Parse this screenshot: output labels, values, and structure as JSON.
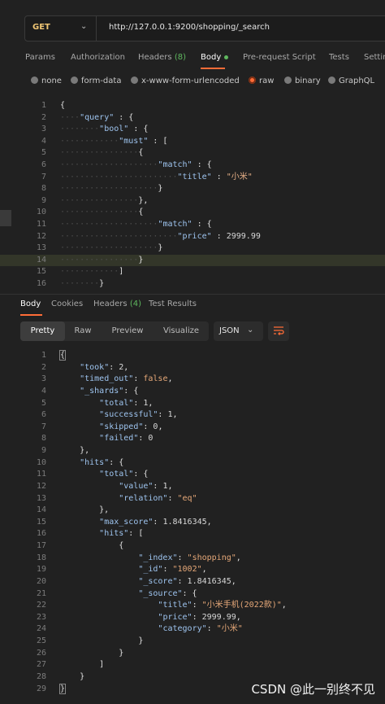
{
  "request": {
    "method": "GET",
    "url": "http://127.0.0.1:9200/shopping/_search"
  },
  "request_tabs": {
    "params": "Params",
    "authorization": "Authorization",
    "headers": "Headers",
    "headers_count": "(8)",
    "body": "Body",
    "pre_request": "Pre-request Script",
    "tests": "Tests",
    "settings": "Settings"
  },
  "body_types": {
    "none": "none",
    "form_data": "form-data",
    "urlencoded": "x-www-form-urlencoded",
    "raw": "raw",
    "binary": "binary",
    "graphql": "GraphQL",
    "selected": "raw"
  },
  "request_body_lines": [
    "{",
    "····\"query\" : {",
    "········\"bool\" : {",
    "············\"must\" : [",
    "················{",
    "····················\"match\" : {",
    "························\"title\" : \"小米\"",
    "····················}",
    "················},",
    "················{",
    "····················\"match\" : {",
    "························\"price\" : 2999.99",
    "····················}",
    "················}",
    "············]",
    "········}"
  ],
  "response_tabs": {
    "body": "Body",
    "cookies": "Cookies",
    "headers": "Headers",
    "headers_count": "(4)",
    "test_results": "Test Results"
  },
  "view_modes": {
    "pretty": "Pretty",
    "raw": "Raw",
    "preview": "Preview",
    "visualize": "Visualize",
    "format": "JSON"
  },
  "response_lines": [
    "{",
    "    \"took\": 2,",
    "    \"timed_out\": false,",
    "    \"_shards\": {",
    "        \"total\": 1,",
    "        \"successful\": 1,",
    "        \"skipped\": 0,",
    "        \"failed\": 0",
    "    },",
    "    \"hits\": {",
    "        \"total\": {",
    "            \"value\": 1,",
    "            \"relation\": \"eq\"",
    "        },",
    "        \"max_score\": 1.8416345,",
    "        \"hits\": [",
    "            {",
    "                \"_index\": \"shopping\",",
    "                \"_id\": \"1002\",",
    "                \"_score\": 1.8416345,",
    "                \"_source\": {",
    "                    \"title\": \"小米手机(2022款)\",",
    "                    \"price\": 2999.99,",
    "                    \"category\": \"小米\"",
    "                }",
    "            }",
    "        ]",
    "    }",
    "}"
  ],
  "watermark": "CSDN @此一别终不见",
  "colors": {
    "accent": "#ff6c37",
    "method": "#f0c674",
    "key": "#9ec4ef",
    "string": "#e6a878"
  }
}
